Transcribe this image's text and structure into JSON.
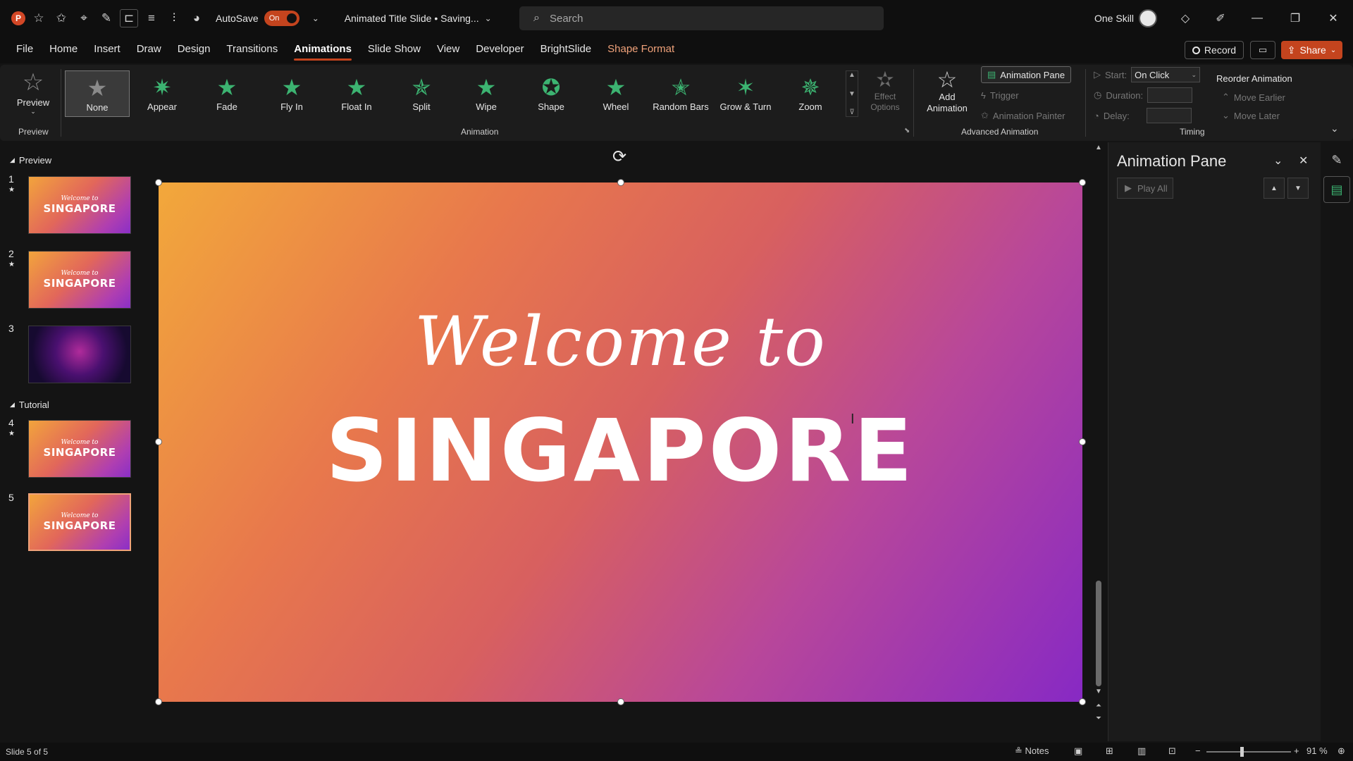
{
  "titlebar": {
    "autosave_label": "AutoSave",
    "autosave_state": "On",
    "doc_title": "Animated Title Slide • Saving...",
    "search_placeholder": "Search",
    "user_name": "One Skill"
  },
  "menu": {
    "items": [
      "File",
      "Home",
      "Insert",
      "Draw",
      "Design",
      "Transitions",
      "Animations",
      "Slide Show",
      "View",
      "Developer",
      "BrightSlide",
      "Shape Format"
    ],
    "active": "Animations",
    "record_label": "Record",
    "share_label": "Share"
  },
  "ribbon": {
    "preview_label": "Preview",
    "preview_group": "Preview",
    "animation_group": "Animation",
    "animations": [
      "None",
      "Appear",
      "Fade",
      "Fly In",
      "Float In",
      "Split",
      "Wipe",
      "Shape",
      "Wheel",
      "Random Bars",
      "Grow & Turn",
      "Zoom"
    ],
    "selected_animation": "None",
    "effect_options_line1": "Effect",
    "effect_options_line2": "Options",
    "add_animation_line1": "Add",
    "add_animation_line2": "Animation",
    "animation_pane_label": "Animation Pane",
    "trigger_label": "Trigger",
    "animation_painter_label": "Animation Painter",
    "advanced_group": "Advanced Animation",
    "start_label": "Start:",
    "start_value": "On Click",
    "duration_label": "Duration:",
    "delay_label": "Delay:",
    "timing_group": "Timing",
    "reorder_label": "Reorder Animation",
    "move_earlier": "Move Earlier",
    "move_later": "Move Later"
  },
  "thumbs": {
    "section1": "Preview",
    "section2": "Tutorial",
    "slides": [
      {
        "num": "1",
        "star": true
      },
      {
        "num": "2",
        "star": true
      },
      {
        "num": "3",
        "star": false
      },
      {
        "num": "4",
        "star": true
      },
      {
        "num": "5",
        "star": false
      }
    ],
    "thumb_welcome": "Welcome to",
    "thumb_title": "SINGAPORE"
  },
  "slide": {
    "welcome": "Welcome to",
    "title": "SINGAPORE"
  },
  "anim_pane": {
    "title": "Animation Pane",
    "play_all": "Play All"
  },
  "status": {
    "slide_info": "Slide 5 of 5",
    "notes_label": "Notes",
    "zoom": "91 %"
  },
  "colors": {
    "accent": "#c4441e",
    "slide_gradient_start": "#f2a83b",
    "slide_gradient_end": "#8729c4",
    "animation_star": "#3cb371"
  }
}
